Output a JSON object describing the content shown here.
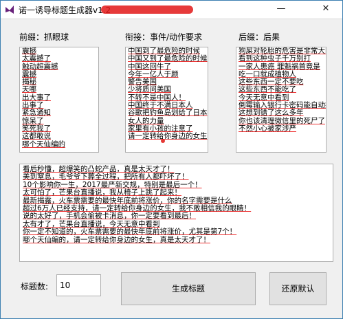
{
  "window": {
    "title": "诺一诱导标题生成器v1.2",
    "minimize_glyph": "—",
    "close_glyph": "✕"
  },
  "prefix": {
    "label": "前缀：抓眼球",
    "items": [
      "震撼",
      "太震撼了",
      "触动超震撼",
      "震撼",
      "揭秘",
      "天哪",
      "出大事了",
      "出事了",
      "紧急通知",
      "惊呆了",
      "笑死我了",
      "这都敢说",
      "哪个天仙编的"
    ]
  },
  "connector": {
    "label": "衔接：事件/动作要求",
    "items": [
      "中国到了最危险的时候",
      "中国又到了最危险的时候",
      "中国这回牛了",
      "今年一亿人于颜",
      "警告美国",
      "少将质问美国",
      "不转不是中国人！",
      "中国终于不满日本人",
      "谷歌把钓鱼岛划给了日本",
      "女人的力量",
      "家里有小孩的注意了",
      "请一定转给你身边的女生"
    ]
  },
  "suffix": {
    "label": "后缀：后果",
    "items": [
      "狗屎对轮胎的危害是非常大的",
      "看到这种虫子千万别打",
      "一家人患癌 罪魁祸首竟是",
      "吃一口就成植物人",
      "这些东西一定不要吃",
      "这些东西不能吃了",
      "今天无意中看到",
      "倒霉输入银行卡密码能自动报警",
      "这想到错了这么多年",
      "你也该清理微信里的死尸了",
      "不然小心被家涉严"
    ]
  },
  "output": {
    "lines": [
      "看后秒懂，超爆笑的凸蛇产品，真是太天才了！",
      "美到窒息，毛爷爷下葬全过程，把所有人都吓坏了！",
      "10个影响你一生，2017最严新交规，特别是最后一个！",
      "太可怕了，芒果台直播说，我从椅子上跳了起来！",
      "最新揭露，火车票需要的最快年底前将涨价，你的名字需要是什么",
      "超过6万人已经支持，请一定转给你身边的女生，我不敢相信我的眼睛！",
      "说的太好了，手机会偷被卡消息，你一定要看到最后！",
      "太有才了，芒果台直播说，今天无意中看到",
      "你一定不知道的，火车票需要的最快年底前将涨价，尤其是第7个！",
      "哪个天仙编的，请一定转给你身边的女生，真是太天才了！"
    ]
  },
  "controls": {
    "count_label": "标题数:",
    "count_value": "10",
    "generate_label": "生成标题",
    "reset_label": "还原默认"
  },
  "colors": {
    "accent": "#3c7fb1",
    "redaction": "#e21818",
    "spellcheck_underline": "#e33333"
  }
}
